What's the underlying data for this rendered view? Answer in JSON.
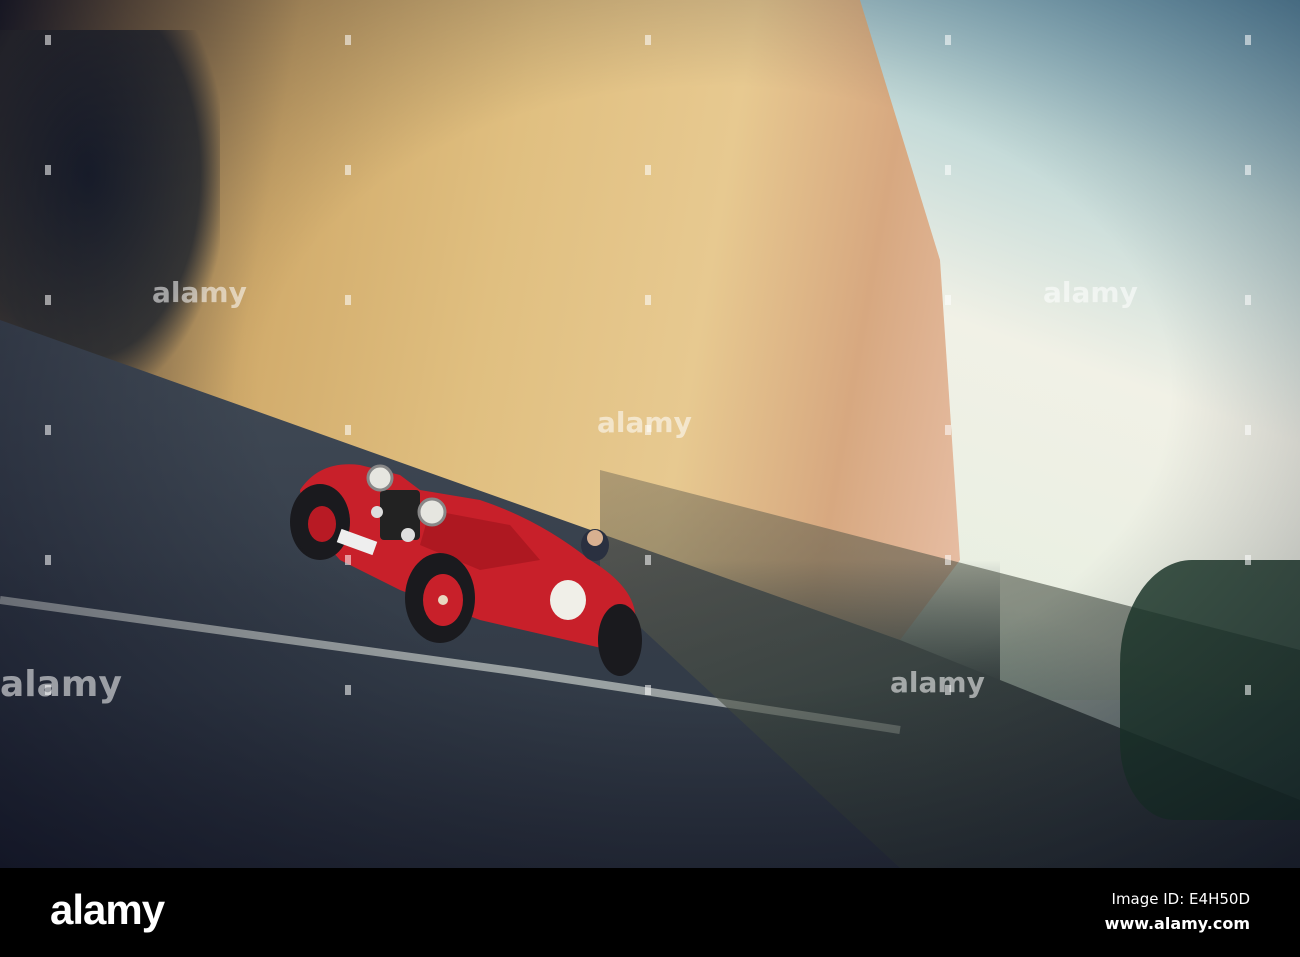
{
  "photo": {
    "subject": "Red vintage race car in motion on city street",
    "watermark_text": "alamy"
  },
  "footer": {
    "logo": "alamy",
    "image_id": "Image ID: E4H50D",
    "website": "www.alamy.com"
  },
  "colors": {
    "car": "#c8202a",
    "footer_bg": "#000000"
  }
}
